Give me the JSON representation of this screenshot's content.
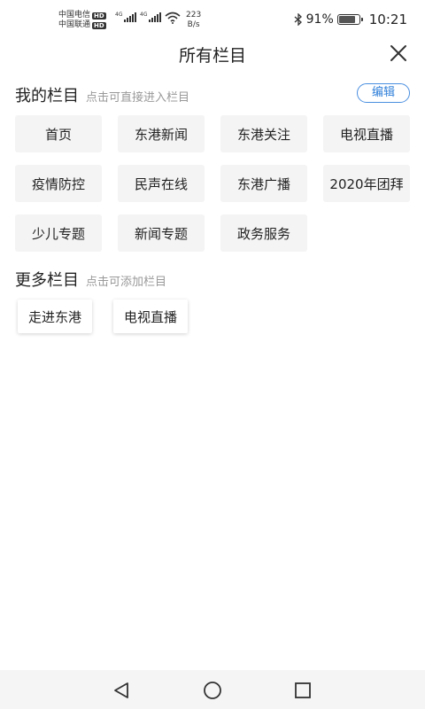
{
  "status_bar": {
    "carrier1": "中国电信",
    "carrier2": "中国联通",
    "hd_label": "HD",
    "signal_label": "4G",
    "net_speed_value": "223",
    "net_speed_unit": "B/s",
    "bluetooth_icon": "bluetooth-icon",
    "battery_percent": "91%",
    "battery_level": 0.91,
    "time": "10:21"
  },
  "header": {
    "title": "所有栏目",
    "close_icon": "close-icon"
  },
  "my_columns": {
    "title": "我的栏目",
    "hint": "点击可直接进入栏目",
    "edit_label": "编辑",
    "accent_color": "#2f7fd9",
    "items": [
      "首页",
      "东港新闻",
      "东港关注",
      "电视直播",
      "疫情防控",
      "民声在线",
      "东港广播",
      "2020年团拜",
      "少儿专题",
      "新闻专题",
      "政务服务"
    ]
  },
  "more_columns": {
    "title": "更多栏目",
    "hint": "点击可添加栏目",
    "items": [
      "走进东港",
      "电视直播"
    ]
  },
  "nav_bar": {
    "back_icon": "back-triangle-icon",
    "home_icon": "home-circle-icon",
    "recents_icon": "recents-square-icon"
  }
}
